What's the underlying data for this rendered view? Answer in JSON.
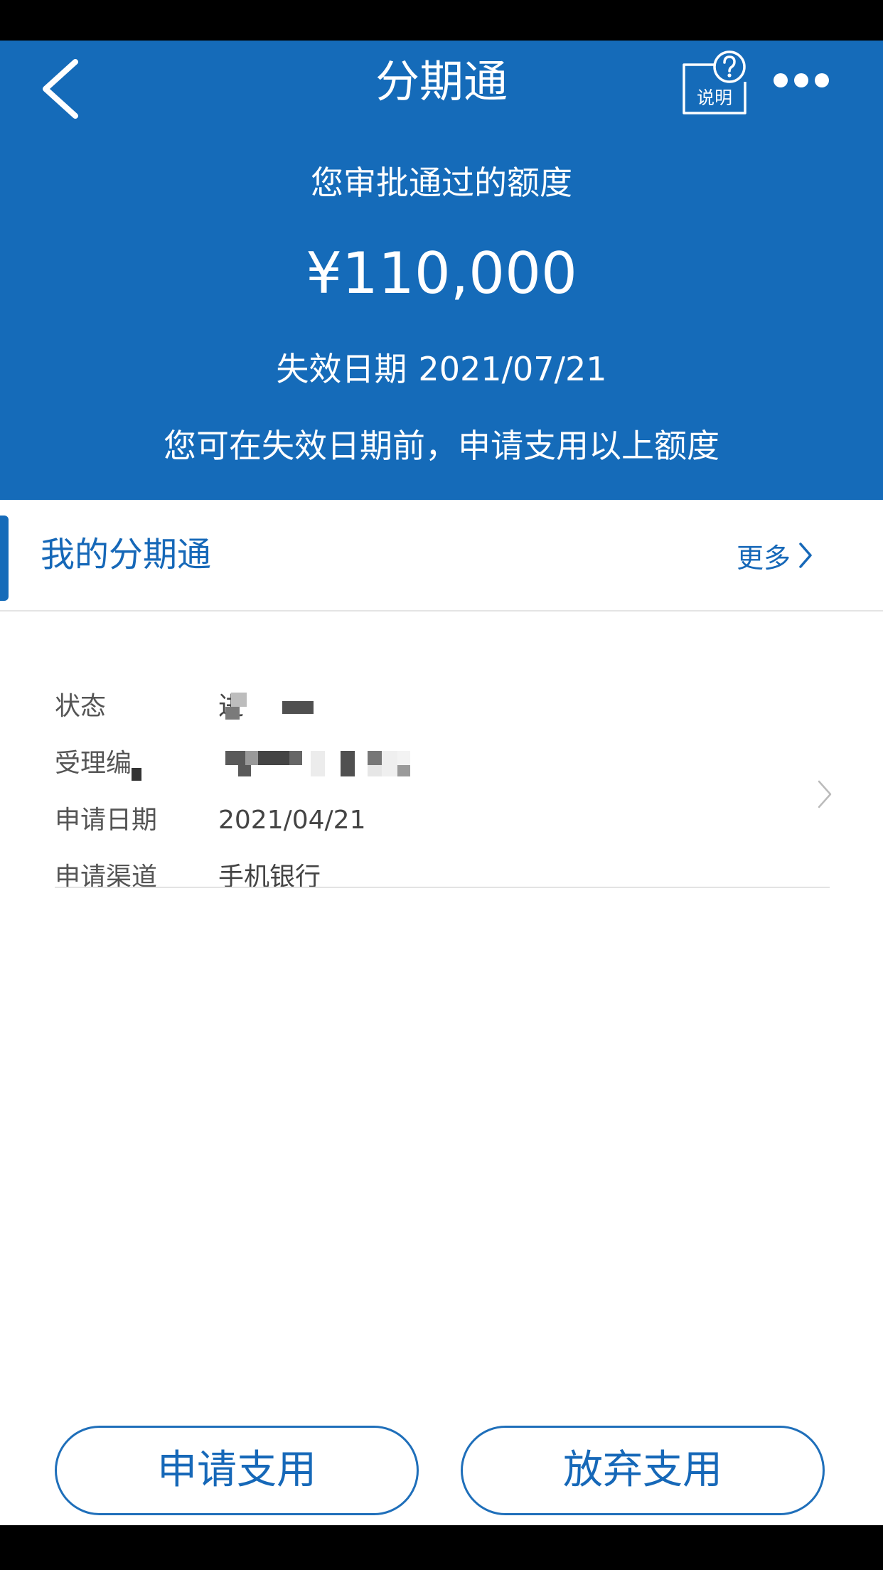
{
  "nav": {
    "title": "分期通",
    "help_label": "说明"
  },
  "summary": {
    "approved_label": "您审批通过的额度",
    "approved_amount": "¥110,000",
    "expiry_label": "失效日期",
    "expiry_date": "2021/07/21",
    "hint": "您可在失效日期前，申请支用以上额度"
  },
  "my_section": {
    "title": "我的分期通",
    "more_label": "更多"
  },
  "record": {
    "status_label": "状态",
    "status_value_visible": "进",
    "number_label": "受理编",
    "date_label": "申请日期",
    "date_value": "2021/04/21",
    "channel_label": "申请渠道",
    "channel_value": "手机银行"
  },
  "actions": {
    "apply_label": "申请支用",
    "giveup_label": "放弃支用"
  },
  "colors": {
    "brand_blue": "#156bb9",
    "link_blue": "#1668b8"
  }
}
